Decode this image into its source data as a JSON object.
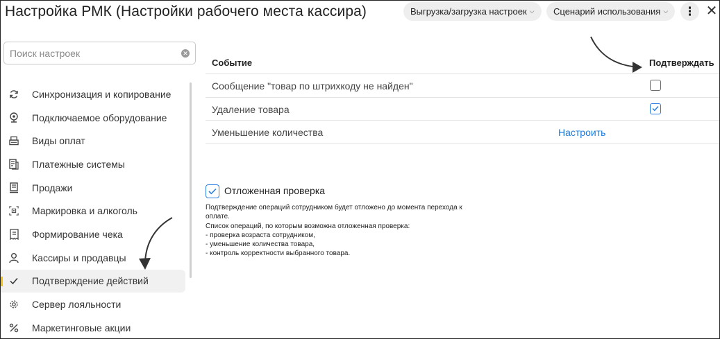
{
  "header": {
    "title": "Настройка РМК (Настройки рабочего места кассира)",
    "export_label": "Выгрузка/загрузка настроек",
    "scenario_label": "Сценарий использования",
    "more_glyph": "⋮",
    "close_glyph": "✕"
  },
  "search": {
    "placeholder": "Поиск настроек"
  },
  "sidebar": {
    "items": [
      {
        "label": "Синхронизация и копирование",
        "icon": "sync-icon"
      },
      {
        "label": "Подключаемое оборудование",
        "icon": "webcam-icon"
      },
      {
        "label": "Виды оплат",
        "icon": "cash-register-icon"
      },
      {
        "label": "Платежные системы",
        "icon": "payment-systems-icon"
      },
      {
        "label": "Продажи",
        "icon": "pos-terminal-icon"
      },
      {
        "label": "Маркировка и алкоголь",
        "icon": "barcode-scan-icon"
      },
      {
        "label": "Формирование чека",
        "icon": "receipt-icon"
      },
      {
        "label": "Кассиры и продавцы",
        "icon": "person-icon"
      },
      {
        "label": "Подтверждение действий",
        "icon": "check-icon",
        "active": true
      },
      {
        "label": "Сервер лояльности",
        "icon": "gear-icon"
      },
      {
        "label": "Маркетинговые акции",
        "icon": "percent-icon"
      }
    ],
    "active_color": "#f3c318"
  },
  "table": {
    "col_event": "Событие",
    "col_confirm": "Подтверждать",
    "rows": [
      {
        "event": "Сообщение \"товар по штрихкоду не найден\"",
        "confirm": false
      },
      {
        "event": "Удаление товара",
        "confirm": true
      },
      {
        "event": "Уменьшение количества",
        "action_label": "Настроить"
      }
    ]
  },
  "deferred": {
    "checked": true,
    "label": "Отложенная проверка",
    "desc_lines": [
      "Подтверждение операций сотрудником будет отложено до момента перехода к",
      "оплате.",
      "Список операций, по которым возможна отложенная проверка:",
      "- проверка возраста сотрудником,",
      "- уменьшение количества товара,",
      "- контроль корректности выбранного товара."
    ]
  },
  "colors": {
    "accent": "#1e7ad9",
    "checkbox_checked": "#2a7ee0",
    "active_marker": "#f3c318"
  }
}
